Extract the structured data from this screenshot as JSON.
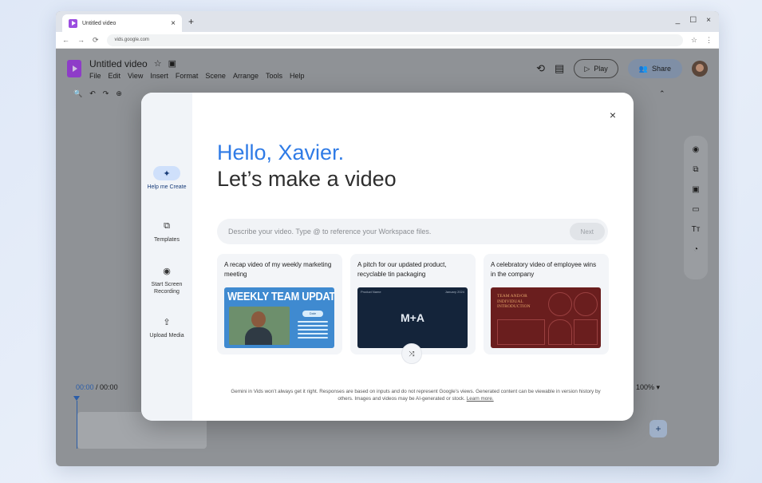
{
  "browser": {
    "tab_title": "Untitled video",
    "tab_close": "×",
    "new_tab": "+",
    "window_controls": [
      "_",
      "☐",
      "×"
    ],
    "url": "vids.google.com"
  },
  "app": {
    "doc_title": "Untitled video",
    "menu": [
      "File",
      "Edit",
      "View",
      "Insert",
      "Format",
      "Scene",
      "Arrange",
      "Tools",
      "Help"
    ],
    "play_label": "Play",
    "share_label": "Share"
  },
  "timeline": {
    "current_time": "00:00",
    "total_time": "/ 00:00",
    "zoom": "100%"
  },
  "modal": {
    "close": "×",
    "greeting": "Hello, Xavier.",
    "headline": "Let’s make a video",
    "prompt_placeholder": "Describe your video. Type @ to reference your Workspace files.",
    "next_label": "Next",
    "rail": [
      {
        "label": "Help me Create",
        "icon": "sparkle-icon",
        "active": true
      },
      {
        "label": "Templates",
        "icon": "templates-icon",
        "active": false
      },
      {
        "label": "Start Screen Recording",
        "icon": "record-icon",
        "active": false
      },
      {
        "label": "Upload Media",
        "icon": "upload-icon",
        "active": false
      }
    ],
    "cards": [
      {
        "title": "A recap video of my weekly marketing meeting",
        "thumb_title": "WEEKLY TEAM UPDATES",
        "thumb_chip": "Date"
      },
      {
        "title": "A pitch for our updated product, recyclable tin packaging",
        "thumb_mark": "M+A",
        "thumb_tl": "Product Name",
        "thumb_tr": "January 2024"
      },
      {
        "title": "A celebratory video of employee wins in the company",
        "thumb_text": "TEAM AND/OR INDIVIDUAL INTRODUCTION"
      }
    ],
    "disclaimer": "Gemini in Vids won’t always get it right. Responses are based on inputs and do not represent Google’s views. Generated content can be viewable in version history by others. Images and videos may be AI-generated or stock.",
    "learn_more": "Learn more."
  },
  "colors": {
    "accent_blue": "#2f7be6",
    "brand_purple": "#8e3cc8"
  }
}
